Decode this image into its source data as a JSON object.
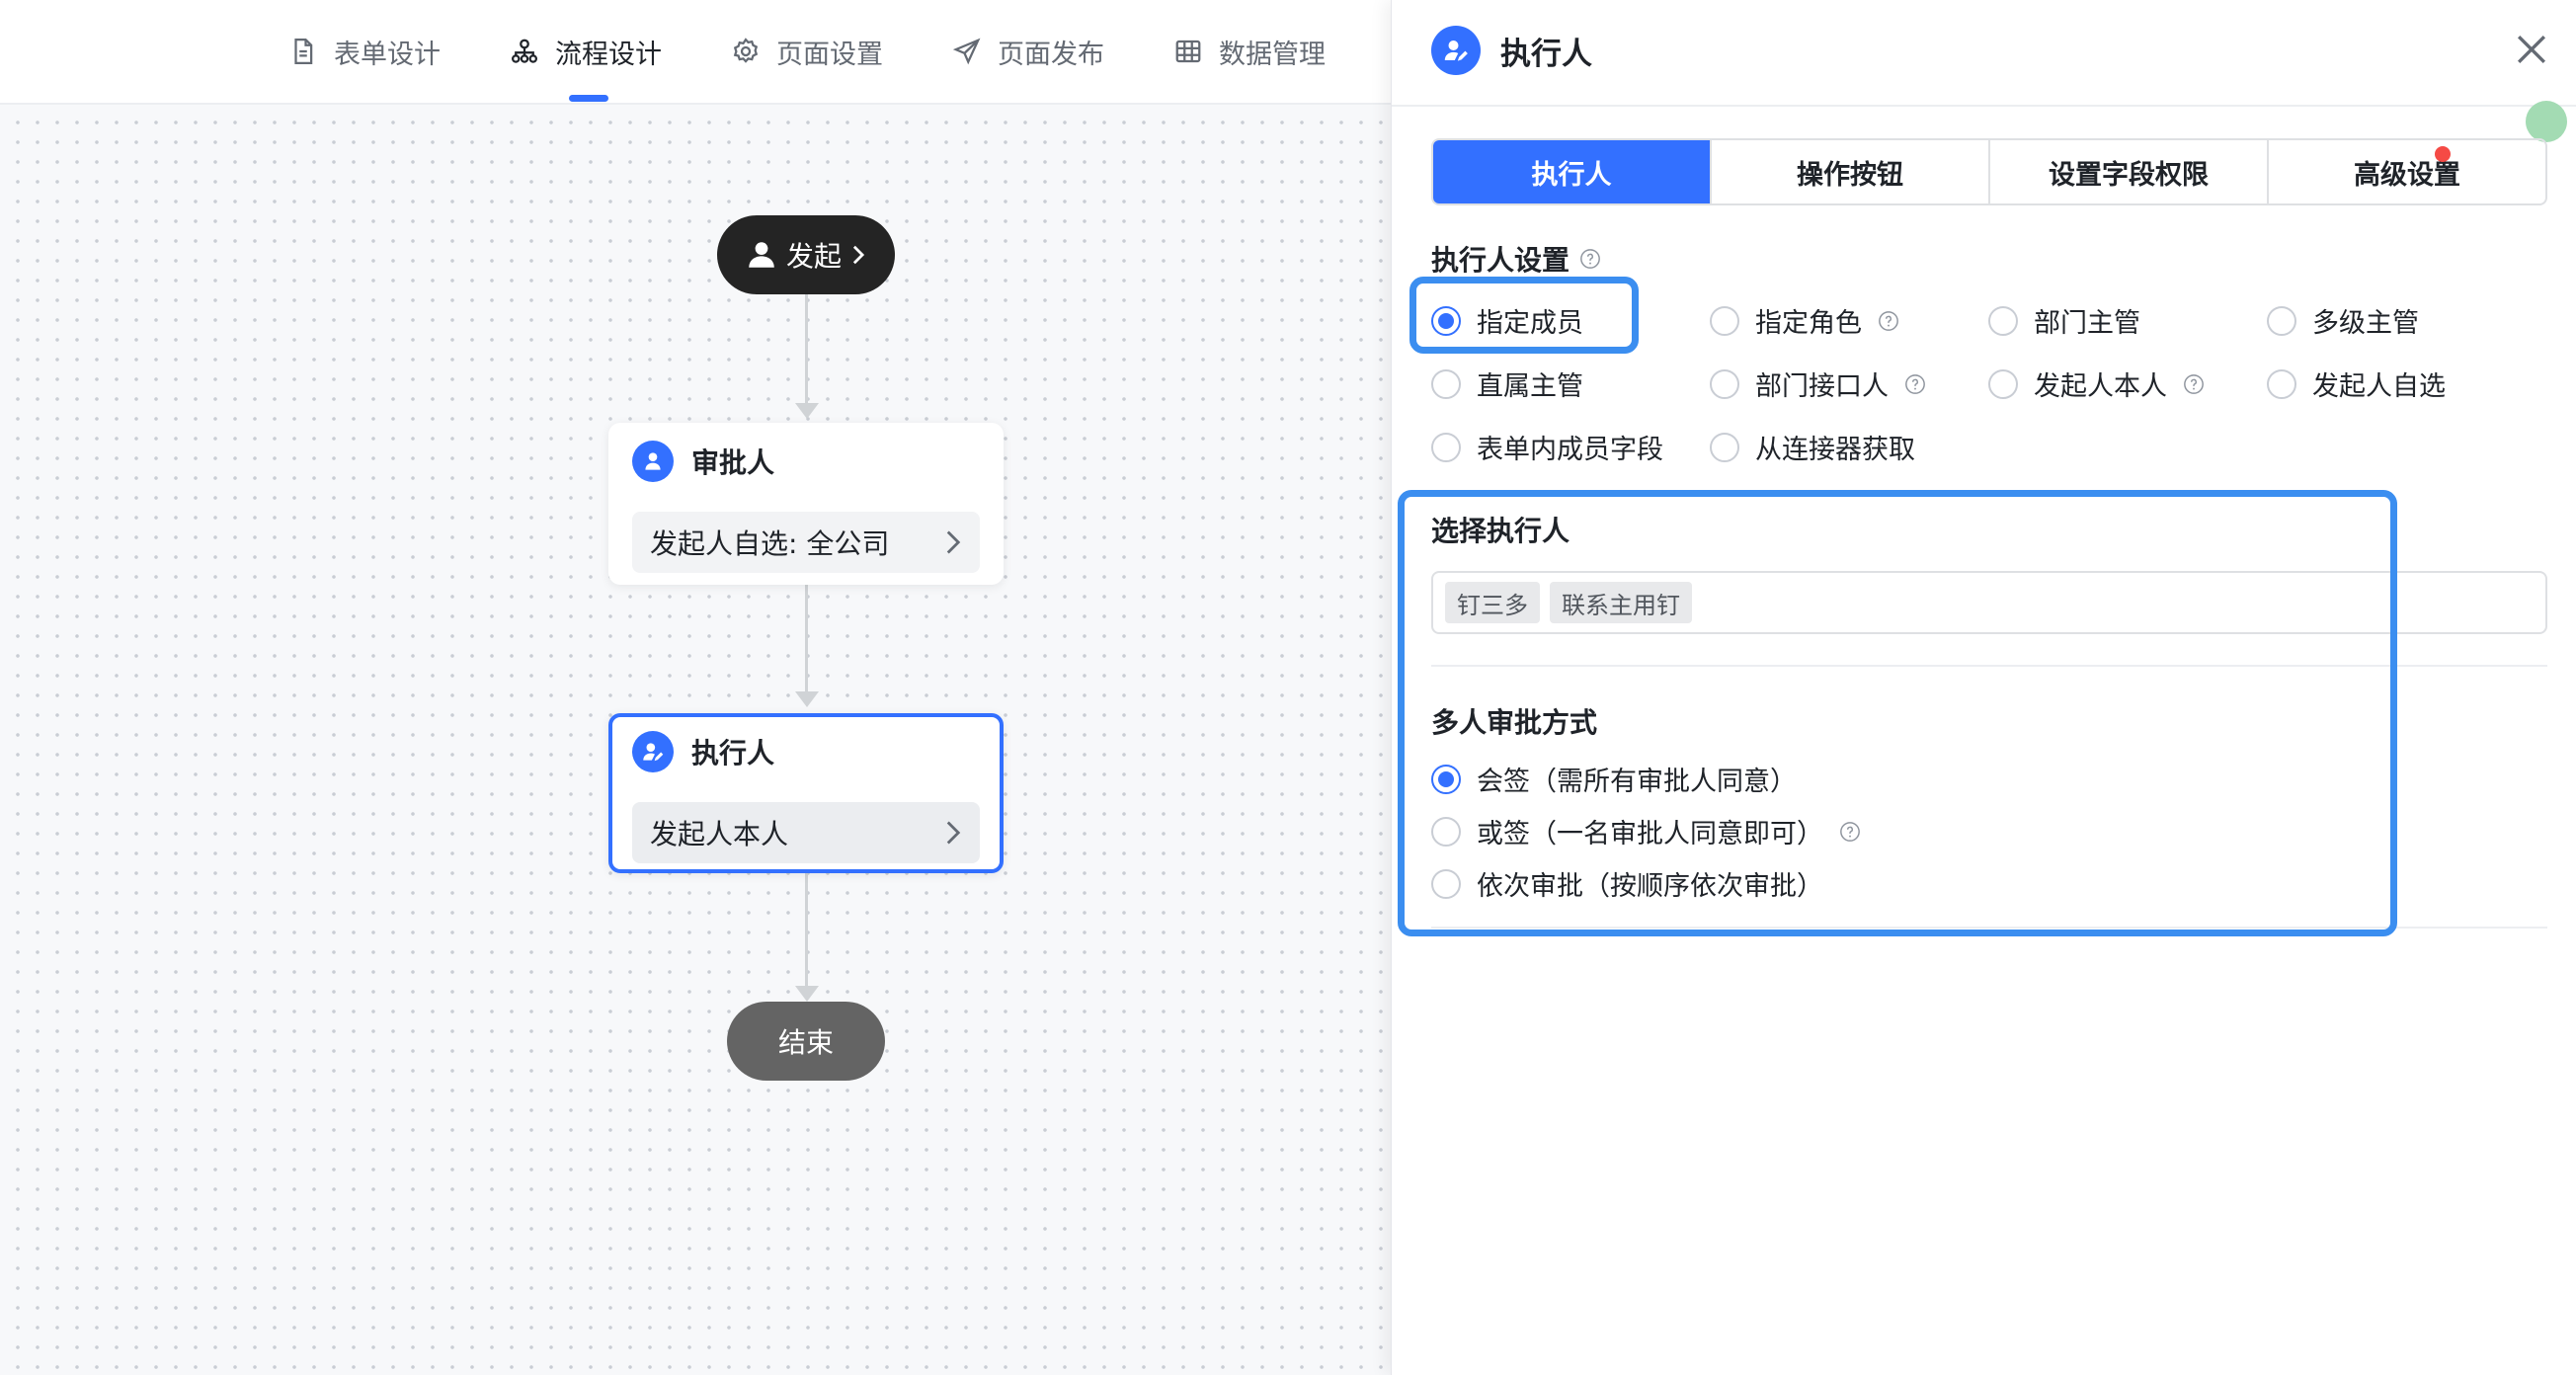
{
  "top_nav": {
    "tabs": [
      {
        "label": "表单设计",
        "icon": "document-icon"
      },
      {
        "label": "流程设计",
        "icon": "flow-tree-icon"
      },
      {
        "label": "页面设置",
        "icon": "gear-icon"
      },
      {
        "label": "页面发布",
        "icon": "send-icon"
      },
      {
        "label": "数据管理",
        "icon": "table-grid-icon"
      }
    ],
    "active_index": 1
  },
  "flow": {
    "start_label": "发起",
    "approver_card": {
      "title": "审批人",
      "summary": "发起人自选: 全公司"
    },
    "executor_card": {
      "title": "执行人",
      "summary": "发起人本人"
    },
    "end_label": "结束"
  },
  "drawer": {
    "title": "执行人",
    "tabs": [
      "执行人",
      "操作按钮",
      "设置字段权限",
      "高级设置"
    ],
    "active_tab": 0,
    "executor_settings": {
      "label": "执行人设置",
      "options": [
        {
          "label": "指定成员",
          "checked": true,
          "help": false
        },
        {
          "label": "指定角色",
          "checked": false,
          "help": true
        },
        {
          "label": "部门主管",
          "checked": false,
          "help": false
        },
        {
          "label": "多级主管",
          "checked": false,
          "help": false
        },
        {
          "label": "直属主管",
          "checked": false,
          "help": false
        },
        {
          "label": "部门接口人",
          "checked": false,
          "help": true
        },
        {
          "label": "发起人本人",
          "checked": false,
          "help": true
        },
        {
          "label": "发起人自选",
          "checked": false,
          "help": false
        },
        {
          "label": "表单内成员字段",
          "checked": false,
          "help": false
        },
        {
          "label": "从连接器获取",
          "checked": false,
          "help": false
        }
      ]
    },
    "select_executor": {
      "label": "选择执行人",
      "tags": [
        "钉三多",
        "联系主用钉"
      ]
    },
    "multi_approval": {
      "label": "多人审批方式",
      "options": [
        {
          "label": "会签（需所有审批人同意）",
          "checked": true,
          "help": false
        },
        {
          "label": "或签（一名审批人同意即可）",
          "checked": false,
          "help": true
        },
        {
          "label": "依次审批（按顺序依次审批）",
          "checked": false,
          "help": false
        }
      ]
    }
  },
  "colors": {
    "accent": "#3370ff",
    "highlight_box": "#3b8ef0",
    "start_node": "#242424",
    "end_node": "#646464",
    "notification_dot": "#f54a45"
  }
}
